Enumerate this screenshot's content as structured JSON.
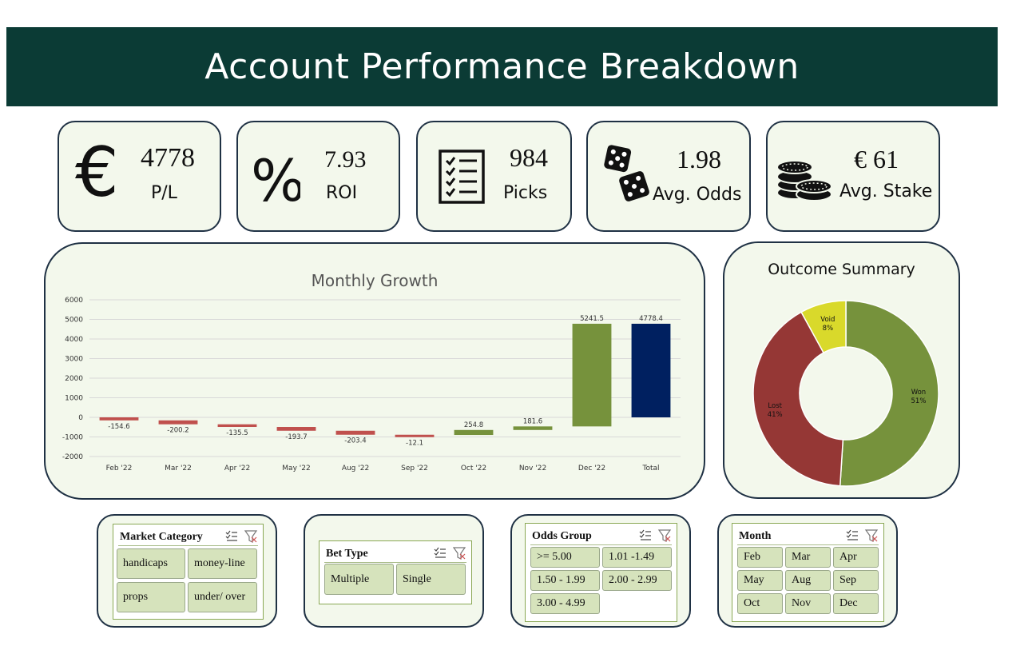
{
  "header": {
    "title": "Account Performance Breakdown"
  },
  "kpis": [
    {
      "icon": "euro-icon",
      "value": "4778",
      "label": "P/L"
    },
    {
      "icon": "percent-icon",
      "value": "7.93",
      "label": "ROI"
    },
    {
      "icon": "checklist-icon",
      "value": "984",
      "label": "Picks"
    },
    {
      "icon": "dice-icon",
      "value": "1.98",
      "label": "Avg. Odds"
    },
    {
      "icon": "coins-icon",
      "value": "€ 61",
      "label": "Avg. Stake"
    }
  ],
  "colors": {
    "banner": "#0b3b35",
    "positive": "#76923c",
    "negative": "#c0504d",
    "total": "#002060",
    "void": "#d9d92b",
    "lost": "#953735",
    "won": "#76923c"
  },
  "chart_data": [
    {
      "type": "bar",
      "subtype": "waterfall",
      "title": "Monthly Growth",
      "categories": [
        "Feb '22",
        "Mar '22",
        "Apr '22",
        "May '22",
        "Aug '22",
        "Sep '22",
        "Oct '22",
        "Nov '22",
        "Dec '22",
        "Total"
      ],
      "values": [
        -154.6,
        -200.2,
        -135.5,
        -193.7,
        -203.4,
        -12.1,
        254.8,
        181.6,
        5241.5,
        4778.4
      ],
      "labels": [
        "-154.6",
        "-200.2",
        "-135.5",
        "-193.7",
        "-203.4",
        "-12.1",
        "254.8",
        "181.6",
        "5241.5",
        "4778.4"
      ],
      "yticks": [
        "6000",
        "5000",
        "4000",
        "3000",
        "2000",
        "1000",
        "0",
        "-1000",
        "-2000"
      ],
      "ylim": [
        -2000,
        6000
      ],
      "grid": true
    },
    {
      "type": "pie",
      "subtype": "donut",
      "title": "Outcome Summary",
      "slices": [
        {
          "name": "Won",
          "value": 51,
          "label": "51%"
        },
        {
          "name": "Lost",
          "value": 41,
          "label": "41%"
        },
        {
          "name": "Void",
          "value": 8,
          "label": "8%"
        }
      ]
    }
  ],
  "slicers": {
    "market": {
      "title": "Market Category",
      "items": [
        "handicaps",
        "money-line",
        "props",
        "under/ over"
      ]
    },
    "bettype": {
      "title": "Bet Type",
      "items": [
        "Multiple",
        "Single"
      ]
    },
    "odds": {
      "title": "Odds Group",
      "items": [
        ">= 5.00",
        "1.01 -1.49",
        "1.50 - 1.99",
        "2.00 - 2.99",
        "3.00 - 4.99"
      ]
    },
    "month": {
      "title": "Month",
      "items": [
        "Feb",
        "Mar",
        "Apr",
        "May",
        "Aug",
        "Sep",
        "Oct",
        "Nov",
        "Dec"
      ]
    }
  }
}
